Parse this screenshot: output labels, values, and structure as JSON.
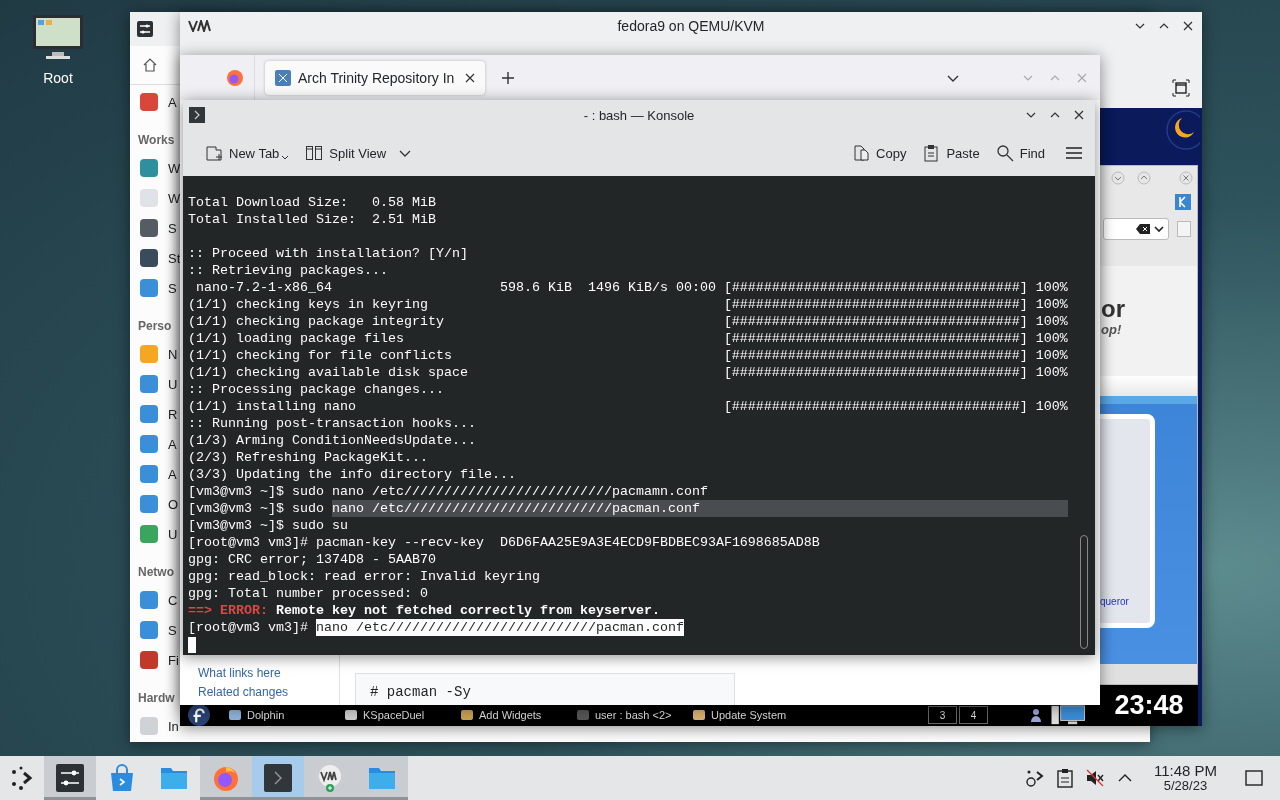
{
  "desktop": {
    "icons": [
      {
        "label": "Root"
      }
    ]
  },
  "settings_window": {
    "sidebar": [
      {
        "kind": "item",
        "label": "A"
      },
      {
        "kind": "header",
        "label": "Works"
      },
      {
        "kind": "item",
        "label": "W"
      },
      {
        "kind": "item",
        "label": "W"
      },
      {
        "kind": "item",
        "label": "S"
      },
      {
        "kind": "item",
        "label": "St"
      },
      {
        "kind": "item",
        "label": "S"
      },
      {
        "kind": "header",
        "label": "Perso"
      },
      {
        "kind": "item",
        "label": "N"
      },
      {
        "kind": "item",
        "label": "U"
      },
      {
        "kind": "item",
        "label": "R"
      },
      {
        "kind": "item",
        "label": "A"
      },
      {
        "kind": "item",
        "label": "A"
      },
      {
        "kind": "item",
        "label": "O"
      },
      {
        "kind": "item",
        "label": "U"
      },
      {
        "kind": "header",
        "label": "Netwo"
      },
      {
        "kind": "item",
        "label": "C"
      },
      {
        "kind": "item",
        "label": "S"
      },
      {
        "kind": "item",
        "label": "Fi"
      },
      {
        "kind": "header",
        "label": "Hardw"
      },
      {
        "kind": "item",
        "label": "In"
      }
    ]
  },
  "vm_window": {
    "title": "fedora9 on QEMU/KVM",
    "guest": {
      "konqueror": {
        "heading": "or",
        "subheading": "op!",
        "link": "queror"
      },
      "panel": {
        "tasks": [
          {
            "label": "Dolphin"
          },
          {
            "label": "KSpaceDuel"
          },
          {
            "label": "Add Widgets"
          },
          {
            "label": "user : bash <2>"
          },
          {
            "label": "Update System"
          }
        ],
        "pager": [
          "3",
          "4"
        ],
        "clock": "23:48"
      }
    }
  },
  "firefox_window": {
    "tabs": [
      {
        "label": "Arch Trinity Repository In",
        "selected": true
      }
    ],
    "sidebar_links": [
      "What links here",
      "Related changes"
    ],
    "code": "# pacman -Sy"
  },
  "konsole_window": {
    "title": "- : bash — Konsole",
    "toolbar_left": [
      {
        "kind": "new-tab",
        "label": "New Tab"
      },
      {
        "kind": "split-view",
        "label": "Split View"
      }
    ],
    "toolbar_right": [
      {
        "kind": "copy",
        "label": "Copy"
      },
      {
        "kind": "paste",
        "label": "Paste"
      },
      {
        "kind": "find",
        "label": "Find"
      }
    ],
    "summary": [
      "Total Download Size:   0.58 MiB",
      "Total Installed Size:  2.51 MiB"
    ],
    "lines": [
      {
        "segments": [
          {
            "kind": "plain",
            "text": ":: Proceed with installation? [Y/n]"
          }
        ]
      },
      {
        "segments": [
          {
            "kind": "plain",
            "text": ":: Retrieving packages..."
          }
        ]
      },
      {
        "segments": [
          {
            "kind": "plain",
            "text": " nano-7.2-1-x86_64                     598.6 KiB  1496 KiB/s 00:00"
          }
        ],
        "bar": "[####################################] 100%"
      },
      {
        "segments": [
          {
            "kind": "plain",
            "text": "(1/1) checking keys in keyring"
          }
        ],
        "bar": "[####################################] 100%"
      },
      {
        "segments": [
          {
            "kind": "plain",
            "text": "(1/1) checking package integrity"
          }
        ],
        "bar": "[####################################] 100%"
      },
      {
        "segments": [
          {
            "kind": "plain",
            "text": "(1/1) loading package files"
          }
        ],
        "bar": "[####################################] 100%"
      },
      {
        "segments": [
          {
            "kind": "plain",
            "text": "(1/1) checking for file conflicts"
          }
        ],
        "bar": "[####################################] 100%"
      },
      {
        "segments": [
          {
            "kind": "plain",
            "text": "(1/1) checking available disk space"
          }
        ],
        "bar": "[####################################] 100%"
      },
      {
        "segments": [
          {
            "kind": "plain",
            "text": ":: Processing package changes..."
          }
        ]
      },
      {
        "segments": [
          {
            "kind": "plain",
            "text": "(1/1) installing nano"
          }
        ],
        "bar": "[####################################] 100%"
      },
      {
        "segments": [
          {
            "kind": "plain",
            "text": ":: Running post-transaction hooks..."
          }
        ]
      },
      {
        "segments": [
          {
            "kind": "plain",
            "text": "(1/3) Arming ConditionNeedsUpdate..."
          }
        ]
      },
      {
        "segments": [
          {
            "kind": "plain",
            "text": "(2/3) Refreshing PackageKit..."
          }
        ]
      },
      {
        "segments": [
          {
            "kind": "plain",
            "text": "(3/3) Updating the info directory file..."
          }
        ]
      },
      {
        "segments": [
          {
            "kind": "plain",
            "text": "[vm3@vm3 ~]$ sudo nano /etc//////////////////////////pacmamn.conf"
          }
        ]
      },
      {
        "segments": [
          {
            "kind": "plain",
            "text": "[vm3@vm3 ~]$ sudo "
          },
          {
            "kind": "selected",
            "text": "nano /etc//////////////////////////pacman.conf"
          }
        ]
      },
      {
        "segments": [
          {
            "kind": "plain",
            "text": "[vm3@vm3 ~]$ sudo su"
          }
        ]
      },
      {
        "segments": [
          {
            "kind": "plain",
            "text": "[root@vm3 vm3]# pacman-key --recv-key  D6D6FAA25E9A3E4ECD9FBDBEC93AF1698685AD8B"
          }
        ]
      },
      {
        "segments": [
          {
            "kind": "plain",
            "text": "gpg: CRC error; 1374D8 - 5AAB70"
          }
        ]
      },
      {
        "segments": [
          {
            "kind": "plain",
            "text": "gpg: read_block: read error: Invalid keyring"
          }
        ]
      },
      {
        "segments": [
          {
            "kind": "plain",
            "text": "gpg: Total number processed: 0"
          }
        ]
      },
      {
        "segments": [
          {
            "kind": "error",
            "text": "==> ERROR:"
          },
          {
            "kind": "bold",
            "text": " Remote key not fetched correctly from keyserver."
          }
        ]
      },
      {
        "segments": [
          {
            "kind": "plain",
            "text": "[root@vm3 vm3]# "
          },
          {
            "kind": "inverse",
            "text": "nano /etc//////////////////////////pacman.conf"
          }
        ]
      }
    ]
  },
  "taskbar": {
    "apps": [
      {
        "kind": "launcher",
        "running": false,
        "selected": false
      },
      {
        "kind": "settings",
        "running": true,
        "selected": false
      },
      {
        "kind": "discover",
        "running": false,
        "selected": false
      },
      {
        "kind": "folder",
        "running": false,
        "selected": false
      },
      {
        "kind": "firefox",
        "running": true,
        "selected": false
      },
      {
        "kind": "terminal",
        "running": true,
        "selected": true
      },
      {
        "kind": "vm",
        "running": true,
        "selected": false
      },
      {
        "kind": "folder",
        "running": true,
        "selected": false
      }
    ],
    "clock": "11:48 PM",
    "date": "5/28/23"
  }
}
